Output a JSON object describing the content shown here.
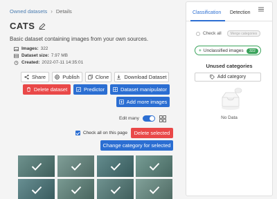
{
  "breadcrumb": {
    "items": [
      "Owned datasets",
      "Details"
    ]
  },
  "dataset": {
    "title": "CATS",
    "description": "Basic dataset containing images from your own sources.",
    "images_label": "Images:",
    "images_value": "322",
    "size_label": "Dataset size:",
    "size_value": "7.97 MB",
    "created_label": "Created:",
    "created_value": "2022-07-11 14:35:01"
  },
  "actions": {
    "share": "Share",
    "publish": "Publish",
    "clone": "Clone",
    "download": "Download Dataset",
    "delete": "Delete dataset",
    "predictor": "Predictor",
    "manipulator": "Dataset manipulator",
    "add_images": "Add more images"
  },
  "view": {
    "edit_many": "Edit many",
    "edit_many_on": true
  },
  "selection": {
    "check_all_page": "Check all on this page",
    "delete_selected": "Delete selected",
    "change_category": "Change category for selected"
  },
  "panel": {
    "tabs": [
      "Classification",
      "Detection"
    ],
    "active_tab": 0,
    "check_all": "Check all",
    "merge_categories": "Merge categories",
    "unclassified": "Unclassified images",
    "unclassified_count": "322",
    "unused_title": "Unused categories",
    "add_category": "Add category",
    "no_data": "No Data"
  },
  "colors": {
    "primary": "#2b6ed2",
    "danger": "#e94848",
    "success": "#3aa35b",
    "link": "#4a7cb0"
  }
}
